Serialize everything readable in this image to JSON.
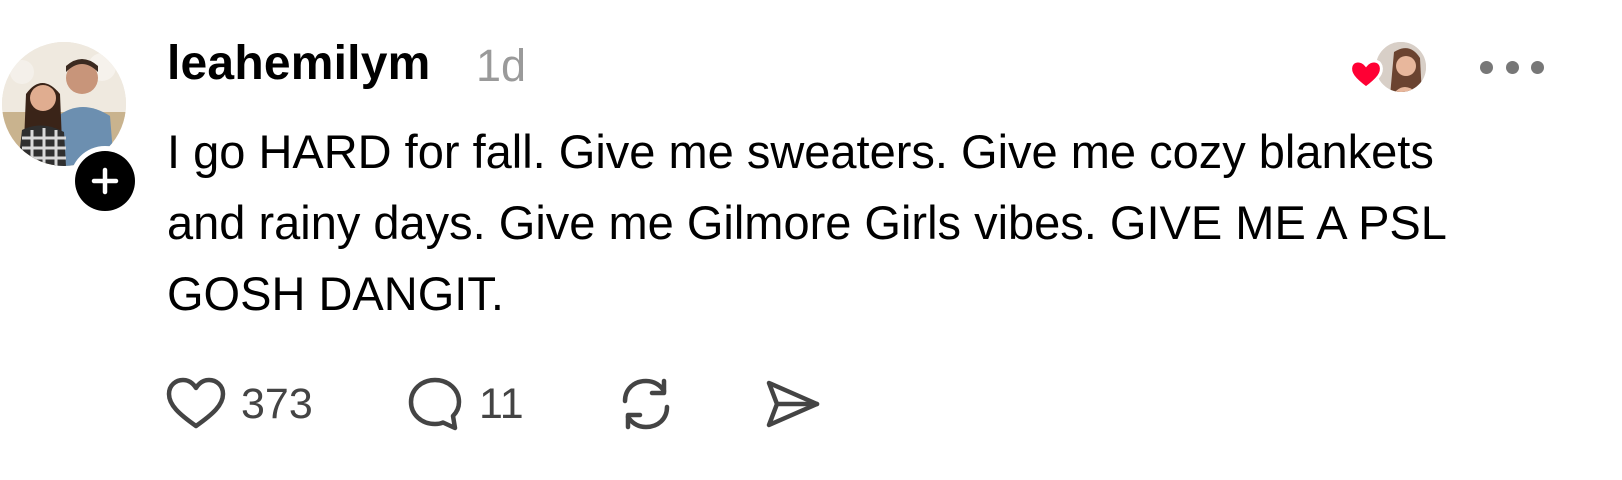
{
  "post": {
    "username": "leahemilym",
    "timestamp": "1d",
    "text": "I go HARD for fall. Give me sweaters. Give me cozy blankets\nand rainy days. Give me Gilmore Girls vibes. GIVE ME A PSL\nGOSH DANGIT.",
    "likes": "373",
    "replies": "11"
  },
  "icons": {
    "avatar": "avatar-photo",
    "follow": "plus-icon",
    "liked_by": "heart-icon",
    "more": "more-dots-icon",
    "like": "heart-outline-icon",
    "reply": "comment-icon",
    "repost": "repost-icon",
    "share": "send-icon"
  },
  "colors": {
    "text": "#000000",
    "muted": "#9a9a9a",
    "action": "#444444",
    "like_red": "#ff0034"
  }
}
